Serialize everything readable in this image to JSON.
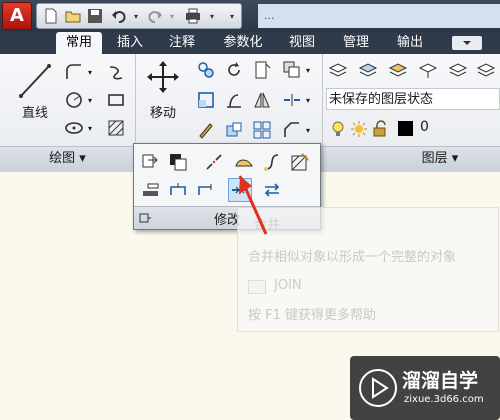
{
  "title_bar": {
    "logo_letter": "A",
    "doc_title": "...",
    "qat_icons": [
      "new-icon",
      "open-icon",
      "save-icon",
      "undo-icon",
      "redo-icon",
      "plot-icon"
    ]
  },
  "tabs": [
    {
      "label": "常用",
      "active": true
    },
    {
      "label": "插入",
      "active": false
    },
    {
      "label": "注释",
      "active": false
    },
    {
      "label": "参数化",
      "active": false
    },
    {
      "label": "视图",
      "active": false
    },
    {
      "label": "管理",
      "active": false
    },
    {
      "label": "输出",
      "active": false
    }
  ],
  "draw_panel": {
    "line_label": "直线",
    "title": "绘图 ▾"
  },
  "modify_panel": {
    "move_label": "移动",
    "flyout_title": "修改"
  },
  "layers_panel": {
    "layer_state": "未保存的图层状态",
    "current_layer": "0",
    "title": "图层 ▾"
  },
  "tooltip": {
    "heading": "合并",
    "description": "合并相似对象以形成一个完整的对象",
    "command": "JOIN",
    "help": "按 F1 键获得更多帮助"
  },
  "watermark": {
    "name": "溜溜自学",
    "url": "zixue.3d66.com"
  },
  "colors": {
    "ribbon_dark": "#2f3a4a",
    "canvas_bg": "#fbf9ee",
    "highlight": "#cfe4f9",
    "logo_red": "#d4271a",
    "arrow_red": "#e03020"
  }
}
